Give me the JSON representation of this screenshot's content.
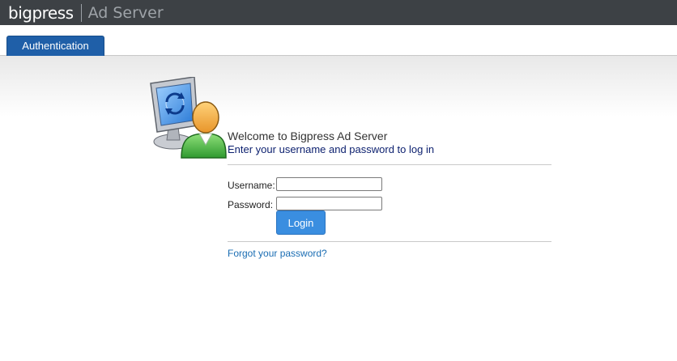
{
  "header": {
    "brand": "bigpress",
    "product": "Ad Server"
  },
  "tabs": [
    {
      "label": "Authentication",
      "active": true
    }
  ],
  "login": {
    "welcome": "Welcome to Bigpress Ad Server",
    "instructions": "Enter your username and password to log in",
    "username_label": "Username:",
    "username_value": "",
    "password_label": "Password:",
    "password_value": "",
    "submit_label": "Login",
    "forgot_link": "Forgot your password?"
  },
  "icons": {
    "login_illustration": "computer-user-refresh-icon"
  },
  "colors": {
    "header_bg": "#3d4145",
    "tab_active": "#1f5fa8",
    "button": "#3a8ee0",
    "link": "#1a6db3",
    "instructions_text": "#0b1f6e"
  }
}
